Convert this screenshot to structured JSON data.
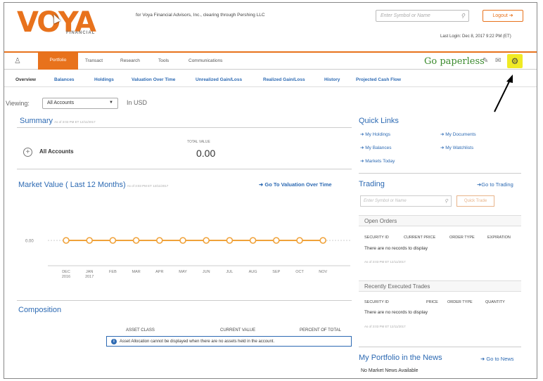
{
  "header": {
    "logo_text": "VOYA",
    "logo_sub": "FINANCIAL",
    "firm_line": "for Voya Financial Advisors, Inc., clearing through Pershing LLC",
    "search_placeholder": "Enter Symbol or Name",
    "logout_label": "Logout",
    "last_login": "Last Login: Dec 8, 2017 9:22 PM (ET)"
  },
  "nav": {
    "items": [
      "Portfolio",
      "Transact",
      "Research",
      "Tools",
      "Communications"
    ],
    "paperless": "Go paperless"
  },
  "subnav": [
    "Overview",
    "Balances",
    "Holdings",
    "Valuation Over Time",
    "Unrealized Gain/Loss",
    "Realized Gain/Loss",
    "History",
    "Projected Cash Flow"
  ],
  "viewing": {
    "label": "Viewing:",
    "selected": "All Accounts",
    "currency": "In USD"
  },
  "summary": {
    "title": "Summary",
    "as_of": "As of 3:03 PM ET 12/11/2017",
    "account": "All Accounts",
    "total_label": "TOTAL VALUE",
    "total_value": "0.00"
  },
  "market": {
    "title": "Market Value ( Last 12 Months)",
    "as_of": "As of 3:03 PM ET 12/11/2017",
    "link": "Go To Valuation Over Time"
  },
  "chart_data": {
    "type": "line",
    "categories": [
      "DEC 2016",
      "JAN 2017",
      "FEB",
      "MAR",
      "APR",
      "MAY",
      "JUN",
      "JUL",
      "AUG",
      "SEP",
      "OCT",
      "NOV"
    ],
    "tick_labels": [
      [
        "DEC",
        "2016"
      ],
      [
        "JAN",
        "2017"
      ],
      [
        "FEB",
        ""
      ],
      [
        "MAR",
        ""
      ],
      [
        "APR",
        ""
      ],
      [
        "MAY",
        ""
      ],
      [
        "JUN",
        ""
      ],
      [
        "JUL",
        ""
      ],
      [
        "AUG",
        ""
      ],
      [
        "SEP",
        ""
      ],
      [
        "OCT",
        ""
      ],
      [
        "NOV",
        ""
      ]
    ],
    "values": [
      0,
      0,
      0,
      0,
      0,
      0,
      0,
      0,
      0,
      0,
      0,
      0
    ],
    "y_tick_label": "0.00",
    "color": "#f0a23a"
  },
  "composition": {
    "title": "Composition",
    "col_asset": "ASSET CLASS",
    "col_value": "CURRENT VALUE",
    "col_pct": "PERCENT OF TOTAL",
    "note": "Asset Allocation cannot be displayed when there are no assets held in the account."
  },
  "quick_links": {
    "title": "Quick Links",
    "links": [
      "My Holdings",
      "My Documents",
      "My Balances",
      "My Watchlists",
      "Markets Today"
    ]
  },
  "trading": {
    "title": "Trading",
    "go": "Go to Trading",
    "placeholder": "Enter Symbol or Name",
    "button": "Quick Trade"
  },
  "open_orders": {
    "title": "Open Orders",
    "cols": [
      "SECURITY ID",
      "CURRENT PRICE",
      "ORDER TYPE",
      "EXPIRATION"
    ],
    "empty": "There are no records to display",
    "as_of": "As of 3:03 PM ET 12/11/2017"
  },
  "recent_trades": {
    "title": "Recently Executed Trades",
    "cols": [
      "SECURITY ID",
      "PRICE",
      "ORDER TYPE",
      "QUANTITY"
    ],
    "empty": "There are no records to display",
    "as_of": "As of 3:03 PM ET 12/11/2017"
  },
  "news": {
    "title": "My Portfolio in the News",
    "go": "Go to News",
    "empty": "No Market News Available"
  },
  "colors": {
    "brand_orange": "#e8721c",
    "link_blue": "#2d6ab3",
    "green": "#3a8a2c",
    "highlight": "#f0ea24"
  }
}
